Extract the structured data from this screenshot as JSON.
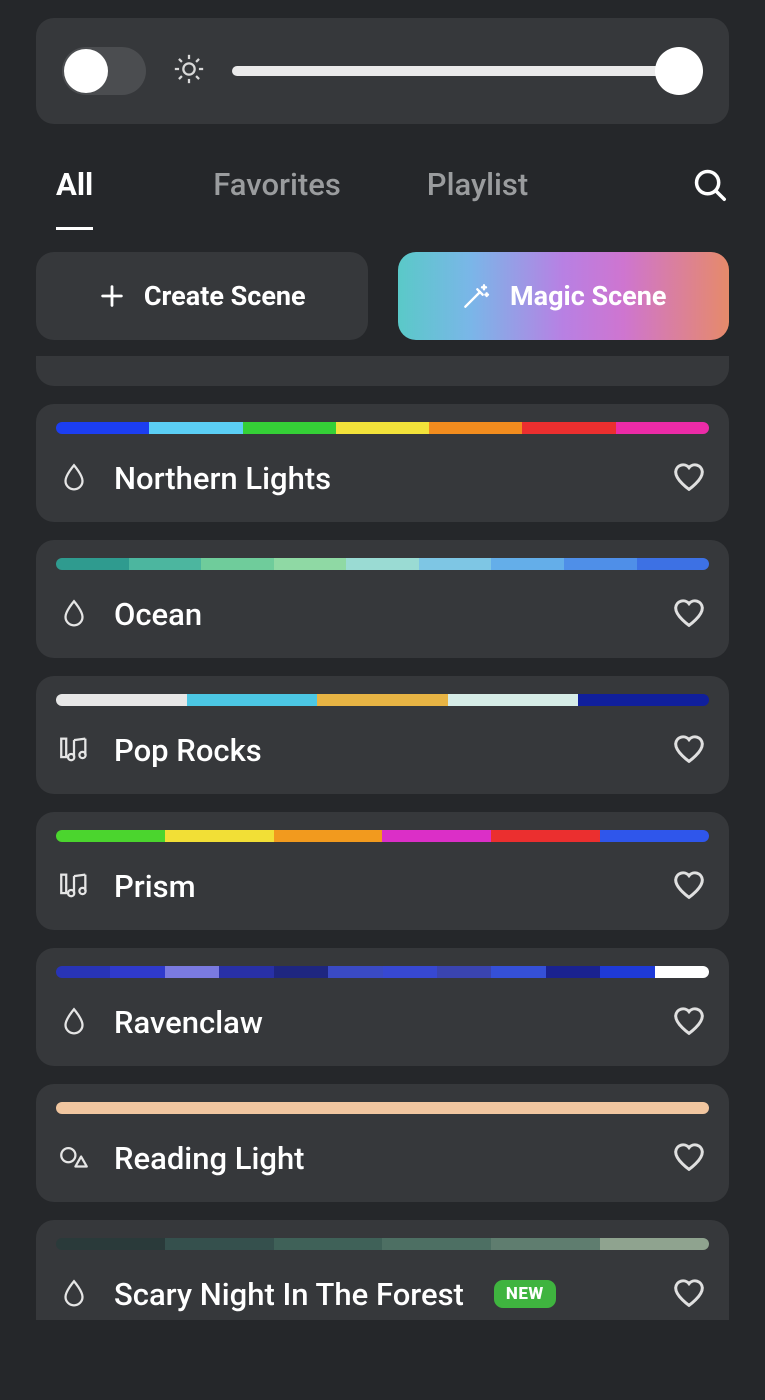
{
  "controls": {
    "power_on": false,
    "brightness_percent": 100
  },
  "tabs": [
    {
      "id": "all",
      "label": "All",
      "active": true
    },
    {
      "id": "favorites",
      "label": "Favorites",
      "active": false
    },
    {
      "id": "playlist",
      "label": "Playlist",
      "active": false
    }
  ],
  "actions": {
    "create": "Create Scene",
    "magic": "Magic Scene"
  },
  "badge_new": "NEW",
  "scenes": [
    {
      "name": "Northern Lights",
      "icon": "droplet",
      "favorite": false,
      "colors": [
        "#1c3ef2",
        "#5bcff5",
        "#35d037",
        "#f2e23a",
        "#f28c1e",
        "#eb2f2f",
        "#ec2ba7"
      ]
    },
    {
      "name": "Ocean",
      "icon": "droplet",
      "favorite": false,
      "colors": [
        "#2f9b8f",
        "#4cb69f",
        "#6fcc9b",
        "#8fd9a4",
        "#9adbd3",
        "#7ec6e4",
        "#64aee9",
        "#4f8fe8",
        "#3d71e4"
      ]
    },
    {
      "name": "Pop Rocks",
      "icon": "music",
      "favorite": false,
      "colors": [
        "#e7e7e7",
        "#4cc7e4",
        "#e7b444",
        "#d6ece7",
        "#101f9c"
      ]
    },
    {
      "name": "Prism",
      "icon": "music",
      "favorite": false,
      "colors": [
        "#4bd52e",
        "#f2df36",
        "#f29a1e",
        "#db2fc7",
        "#eb2f2f",
        "#2f56eb"
      ]
    },
    {
      "name": "Ravenclaw",
      "icon": "droplet",
      "favorite": false,
      "colors": [
        "#2834b6",
        "#2f3acc",
        "#7a7ae0",
        "#2830a6",
        "#1e2680",
        "#3a4ac4",
        "#3748d2",
        "#3a44b0",
        "#3550d8",
        "#1a2290",
        "#1e3ad8",
        "#ffffff"
      ]
    },
    {
      "name": "Reading Light",
      "icon": "shapes",
      "favorite": false,
      "colors": [
        "#f1c6a0"
      ]
    },
    {
      "name": "Scary Night In The Forest",
      "icon": "droplet",
      "favorite": false,
      "badge": "NEW",
      "partial": true,
      "colors": [
        "#2a3a3a",
        "#35504d",
        "#3f6158",
        "#4d6f63",
        "#5f7d6f",
        "#8fa38f"
      ]
    }
  ]
}
